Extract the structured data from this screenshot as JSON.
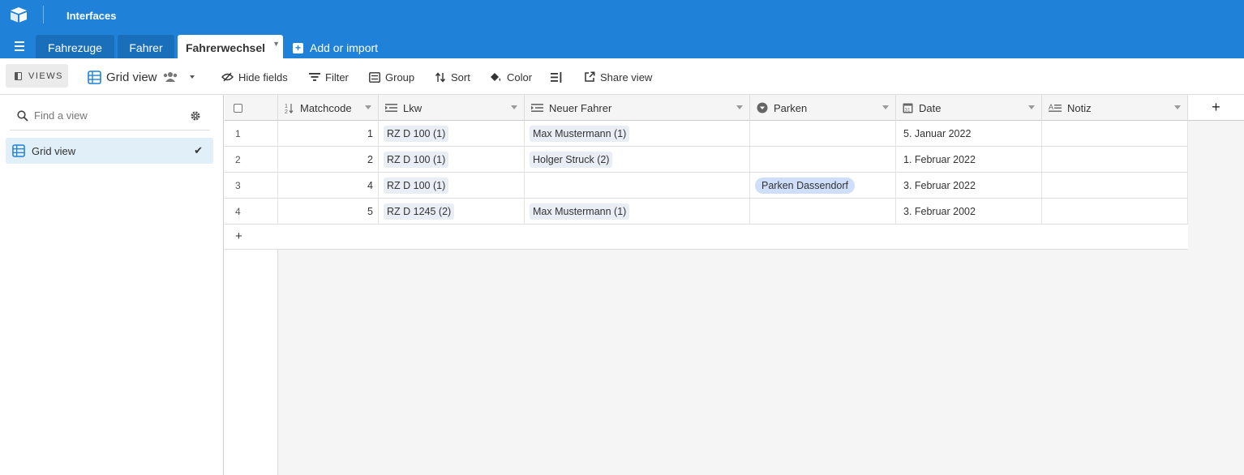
{
  "header": {
    "title": "Interfaces"
  },
  "tabs": [
    {
      "label": "Fahrezuge"
    },
    {
      "label": "Fahrer"
    },
    {
      "label": "Fahrerwechsel"
    }
  ],
  "add_import_label": "Add or import",
  "toolbar": {
    "views_label": "VIEWS",
    "view_name": "Grid view",
    "hide_fields": "Hide fields",
    "filter": "Filter",
    "group": "Group",
    "sort": "Sort",
    "color": "Color",
    "share_view": "Share view"
  },
  "sidebar": {
    "search_placeholder": "Find a view",
    "views": [
      {
        "label": "Grid view",
        "selected": true
      }
    ]
  },
  "columns": [
    {
      "label": "Matchcode",
      "icon": "autonumber-icon"
    },
    {
      "label": "Lkw",
      "icon": "link-icon"
    },
    {
      "label": "Neuer Fahrer",
      "icon": "link-icon"
    },
    {
      "label": "Parken",
      "icon": "single-select-icon"
    },
    {
      "label": "Date",
      "icon": "calendar-icon"
    },
    {
      "label": "Notiz",
      "icon": "long-text-icon"
    }
  ],
  "rows": [
    {
      "num": "1",
      "matchcode": "1",
      "lkw": "RZ D 100 (1)",
      "fahrer": "Max Mustermann (1)",
      "parken": "",
      "date": "5. Januar 2022",
      "notiz": ""
    },
    {
      "num": "2",
      "matchcode": "2",
      "lkw": "RZ D 100 (1)",
      "fahrer": "Holger Struck (2)",
      "parken": "",
      "date": "1. Februar 2022",
      "notiz": ""
    },
    {
      "num": "3",
      "matchcode": "4",
      "lkw": "RZ D 100 (1)",
      "fahrer": "",
      "parken": "Parken Dassendorf",
      "date": "3. Februar 2022",
      "notiz": ""
    },
    {
      "num": "4",
      "matchcode": "5",
      "lkw": "RZ D 1245 (2)",
      "fahrer": "Max Mustermann (1)",
      "parken": "",
      "date": "3. Februar 2002",
      "notiz": ""
    }
  ],
  "colors": {
    "brand": "#1f82d8",
    "tab_inactive": "#1a6fba",
    "select_pill": "#cfdffb",
    "link_pill": "#e9eef6",
    "selected_view": "#e1eff9"
  }
}
